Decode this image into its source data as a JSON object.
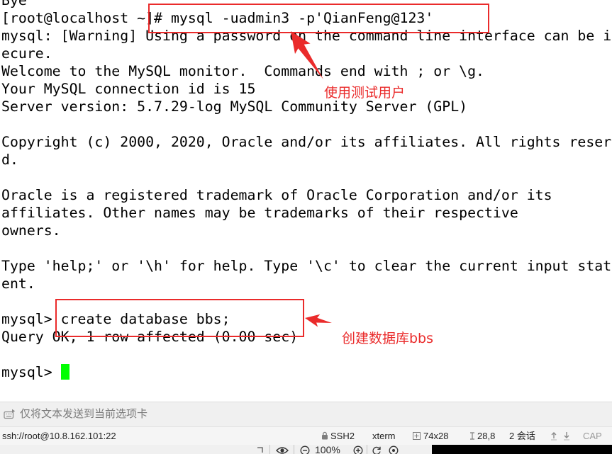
{
  "terminal": {
    "lines": [
      "Bye",
      "[root@localhost ~]# mysql -uadmin3 -p'QianFeng@123'",
      "mysql: [Warning] Using a password on the command line interface can be i",
      "ecure.",
      "Welcome to the MySQL monitor.  Commands end with ; or \\g.",
      "Your MySQL connection id is 15",
      "Server version: 5.7.29-log MySQL Community Server (GPL)",
      "",
      "Copyright (c) 2000, 2020, Oracle and/or its affiliates. All rights reser",
      "d.",
      "",
      "Oracle is a registered trademark of Oracle Corporation and/or its",
      "affiliates. Other names may be trademarks of their respective",
      "owners.",
      "",
      "Type 'help;' or '\\h' for help. Type '\\c' to clear the current input stat",
      "ent.",
      "",
      "mysql> create database bbs;",
      "Query OK, 1 row affected (0.00 sec)",
      "",
      "mysql> "
    ],
    "colors": {
      "text": "#000000",
      "background": "#ffffff",
      "cursor": "#00ff00"
    }
  },
  "annotations": {
    "color": "#ea2b2b",
    "login_note": "使用测试用户",
    "create_db_note": "创建数据库bbs"
  },
  "send_bar": {
    "icon": "keyboard-send-icon",
    "text": "仅将文本发送到当前选项卡"
  },
  "status_bar": {
    "connection": "ssh://root@10.8.162.101:22",
    "protocol_icon": "lock-icon",
    "protocol": "SSH2",
    "terminal_type": "xterm",
    "size_icon": "resize-icon",
    "size": "74x28",
    "cursor_icon": "cursor-position-icon",
    "cursor_position": "28,8",
    "sessions": "2 会话",
    "transfer_icons": [
      "arrow-up-icon",
      "arrow-down-icon"
    ],
    "caps_lock": "CAP"
  },
  "viewer_toolbar": {
    "icons": [
      "grip-icon",
      "eye-icon",
      "zoom-out-icon",
      "zoom-in-icon",
      "rotate-icon",
      "fit-icon"
    ],
    "zoom": "100%"
  }
}
